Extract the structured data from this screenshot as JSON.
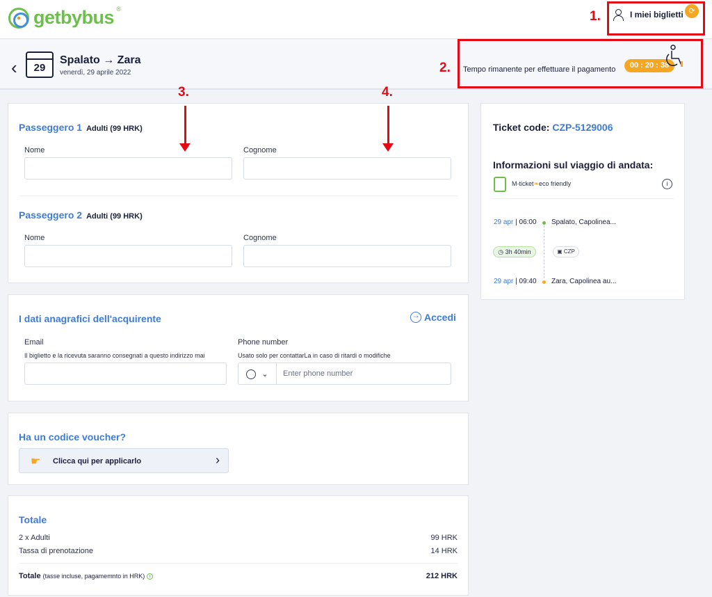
{
  "header": {
    "logo_text": "getbybus",
    "my_tickets_label": "I miei biglietti"
  },
  "annotations": [
    "1.",
    "2.",
    "3.",
    "4."
  ],
  "trip_header": {
    "calendar_day": "29",
    "route": "Spalato → Zara",
    "date": "venerdì, 29 aprile 2022",
    "remaining_label": "Tempo rimanente per effettuare il pagamento",
    "timer": "00 : 20 : 38"
  },
  "passengers": [
    {
      "title": "Passeggero 1",
      "type": "Adulti (99 HRK)",
      "first_name_label": "Nome",
      "last_name_label": "Cognome"
    },
    {
      "title": "Passeggero 2",
      "type": "Adulti (99 HRK)",
      "first_name_label": "Nome",
      "last_name_label": "Cognome"
    }
  ],
  "buyer": {
    "title": "I dati anagrafici dell'acquirente",
    "login_label": "Accedi",
    "email_label": "Email",
    "email_help": "Il biglietto e la ricevuta saranno consegnati a questo indirizzo mai",
    "phone_label": "Phone number",
    "phone_help": "Usato solo per contattarLa in caso di ritardi o modifiche",
    "phone_placeholder": "Enter phone number"
  },
  "voucher": {
    "title": "Ha un codice voucher?",
    "button_label": "Clicca qui per applicarlo"
  },
  "totals": {
    "title": "Totale",
    "rows": [
      {
        "label": "2 x Adulti",
        "amount": "99 HRK"
      },
      {
        "label": "Tassa di prenotazione",
        "amount": "14 HRK"
      }
    ],
    "total_label": "Totale",
    "total_note": "(tasse incluse, pagamemnto in HRK)",
    "total_amount": "212 HRK"
  },
  "trip_info": {
    "ticket_code_label": "Ticket code:",
    "ticket_code": "CZP-5129006",
    "title": "Informazioni sul viaggio di andata:",
    "mticket": "M-ticket",
    "eco": "eco friendly",
    "departure_date": "29 apr",
    "departure_time": "06:00",
    "departure_stop": "Spalato, Capolinea...",
    "duration": "3h 40min",
    "carrier": "CZP",
    "arrival_date": "29 apr",
    "arrival_time": "09:40",
    "arrival_stop": "Zara, Capolinea au..."
  },
  "colors": {
    "accent_blue": "#3d7bd9",
    "brand_green": "#6cc04a",
    "timer_orange": "#f5a623",
    "annotation_red": "#e50914"
  }
}
